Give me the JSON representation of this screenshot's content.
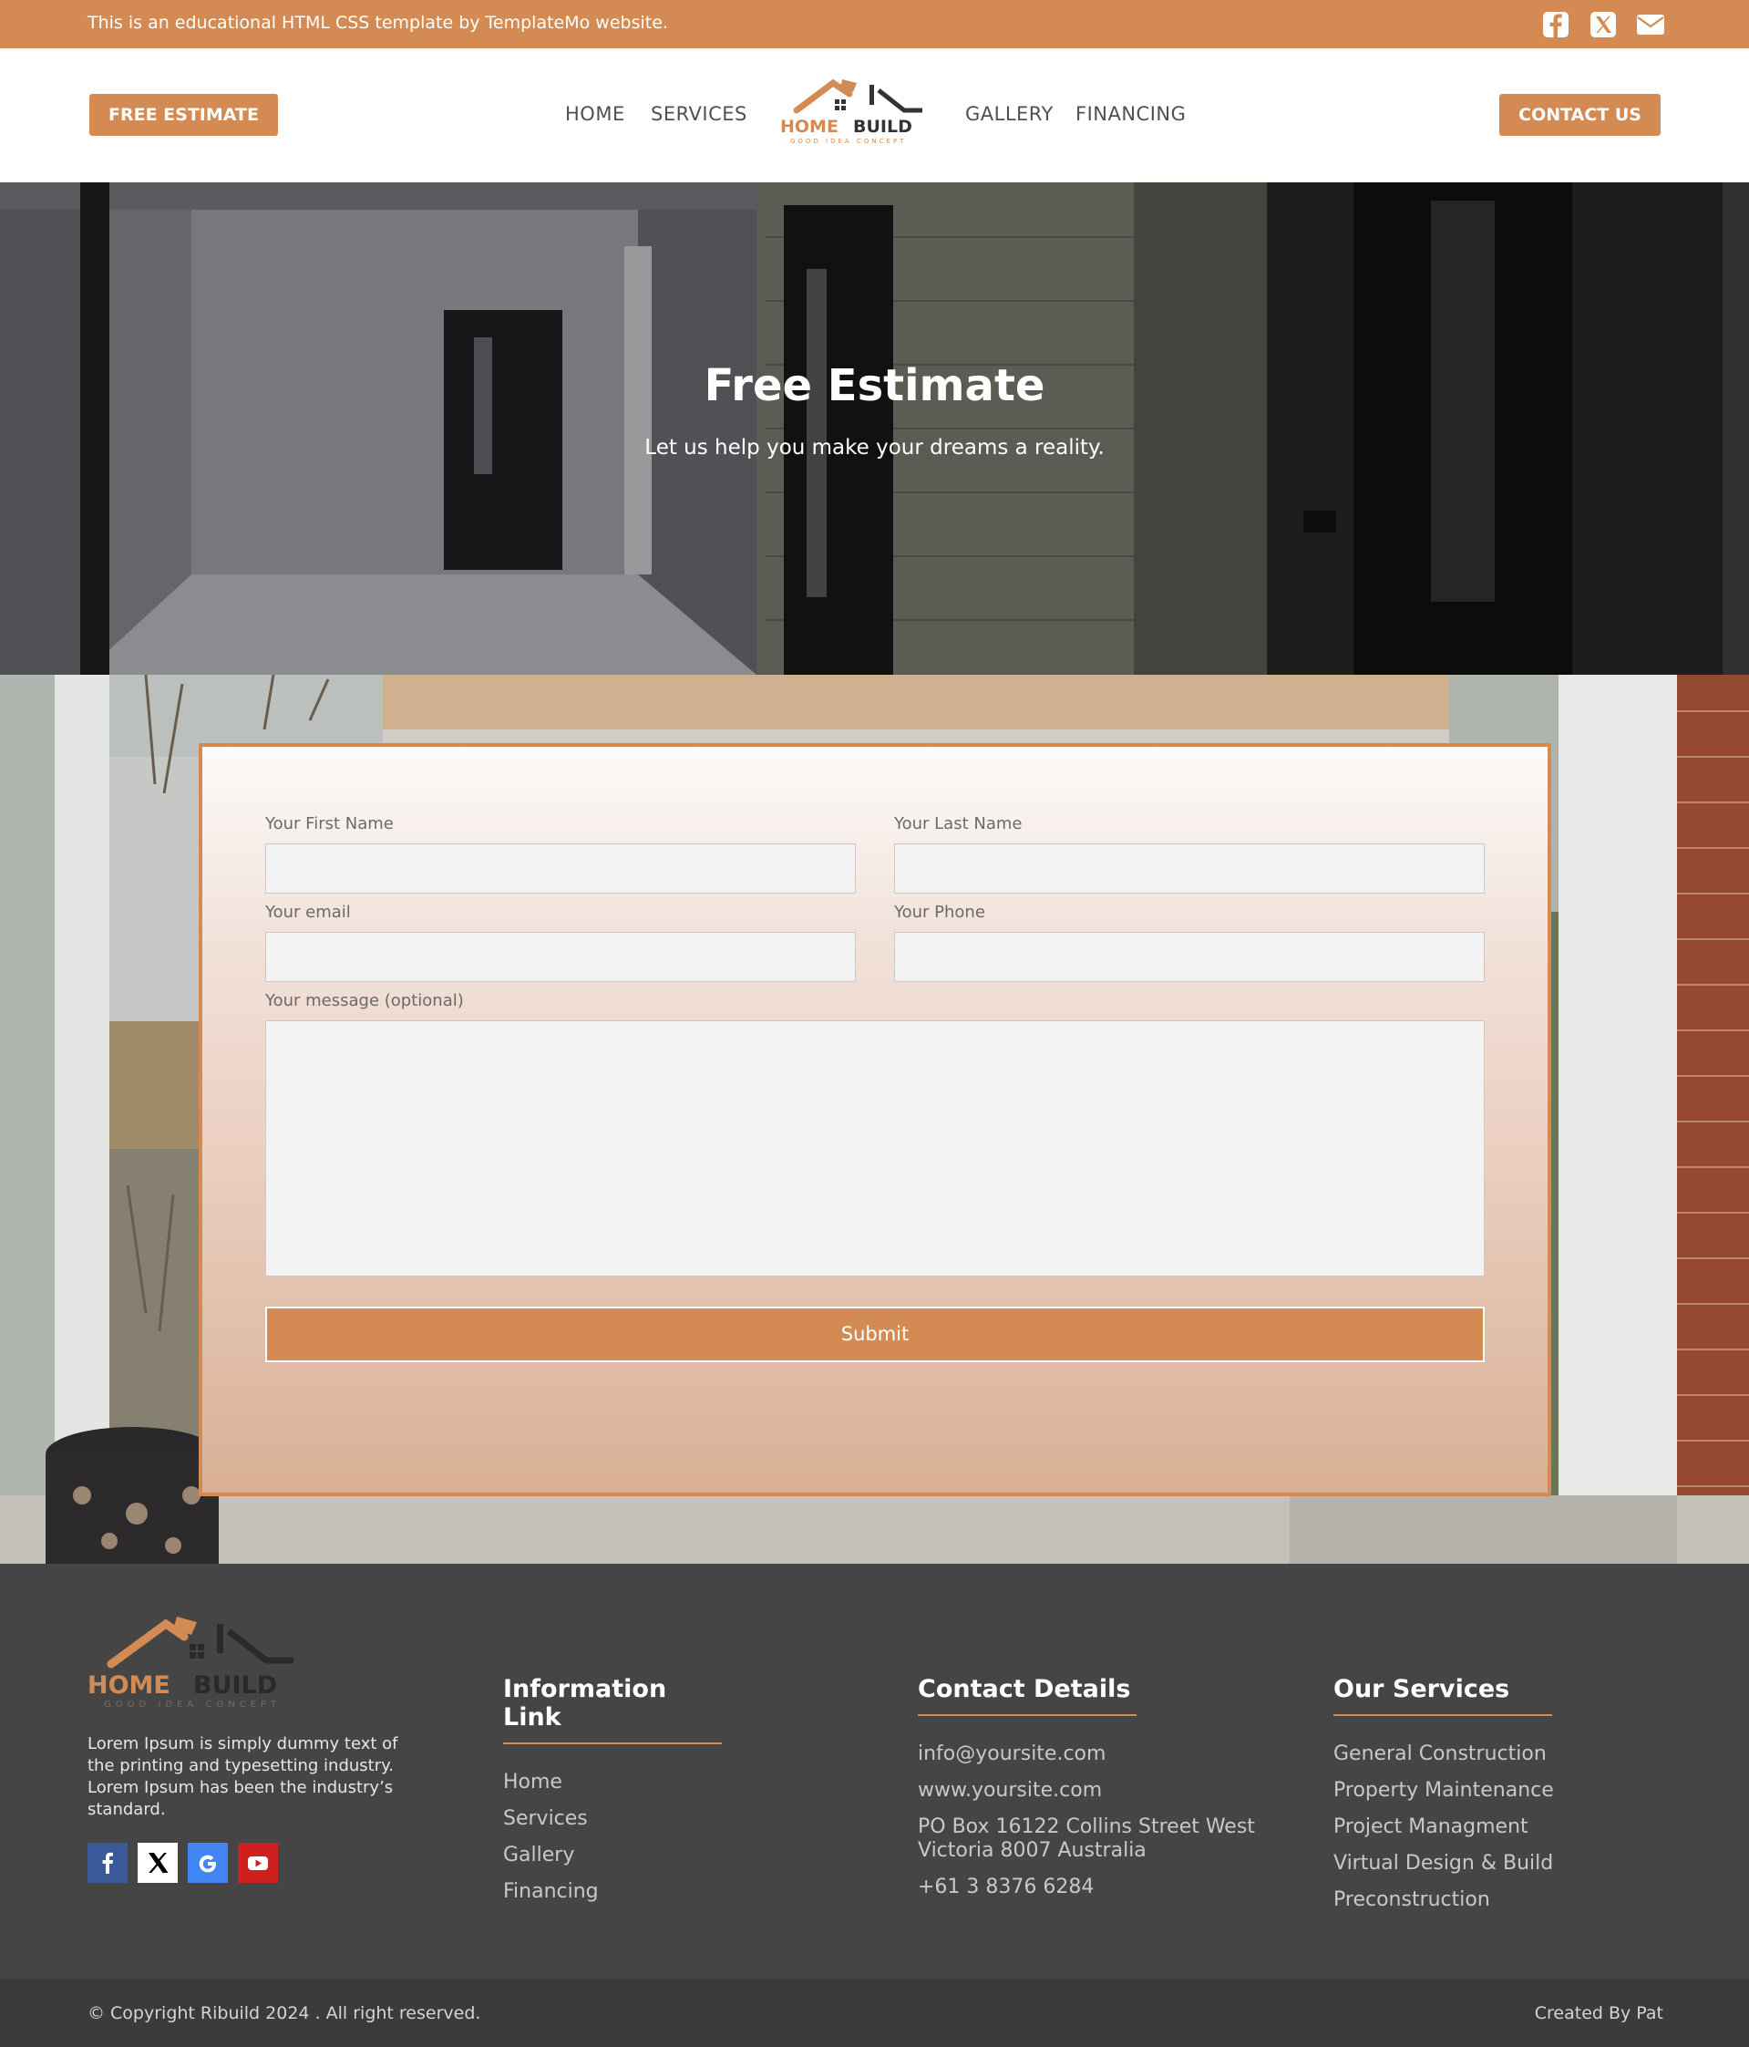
{
  "topbar": {
    "message": "This is an educational HTML CSS template by TemplateMo website.",
    "icons": [
      "facebook-icon",
      "x-twitter-icon",
      "envelope-icon"
    ]
  },
  "header": {
    "free_estimate": "FREE ESTIMATE",
    "contact_us": "CONTACT US",
    "nav": [
      "HOME",
      "SERVICES",
      "GALLERY",
      "FINANCING"
    ],
    "logo": {
      "brand_a": "HOME",
      "brand_b": "BUILD",
      "tagline": "GOOD IDEA CONCEPT"
    }
  },
  "hero": {
    "title": "Free Estimate",
    "subtitle": "Let us help you make your dreams a reality."
  },
  "form": {
    "first_name_label": "Your First Name",
    "last_name_label": "Your Last Name",
    "email_label": "Your email",
    "phone_label": "Your Phone",
    "message_label": "Your message (optional)",
    "submit": "Submit"
  },
  "footer": {
    "about": "Lorem Ipsum is simply dummy text of the printing and typesetting industry. Lorem Ipsum has been the industry’s standard.",
    "info_title": "Information Link",
    "info_links": [
      "Home",
      "Services",
      "Gallery",
      "Financing"
    ],
    "contact_title": "Contact Details",
    "contact": [
      "info@yoursite.com",
      "www.yoursite.com",
      "PO Box 16122 Collins Street West Victoria 8007 Australia",
      "+61 3 8376 6284"
    ],
    "services_title": "Our Services",
    "services": [
      "General Construction",
      "Property Maintenance",
      "Project Managment",
      "Virtual Design & Build",
      "Preconstruction"
    ],
    "social_icons": [
      "facebook-icon",
      "x-twitter-icon",
      "google-icon",
      "youtube-icon"
    ],
    "copyright": "© Copyright Ribuild 2024 . All right reserved.",
    "created_by": "Created By Pat"
  },
  "colors": {
    "accent": "#d38b53",
    "footer_bg": "#454545",
    "copy_bg": "#3b3b3b"
  }
}
